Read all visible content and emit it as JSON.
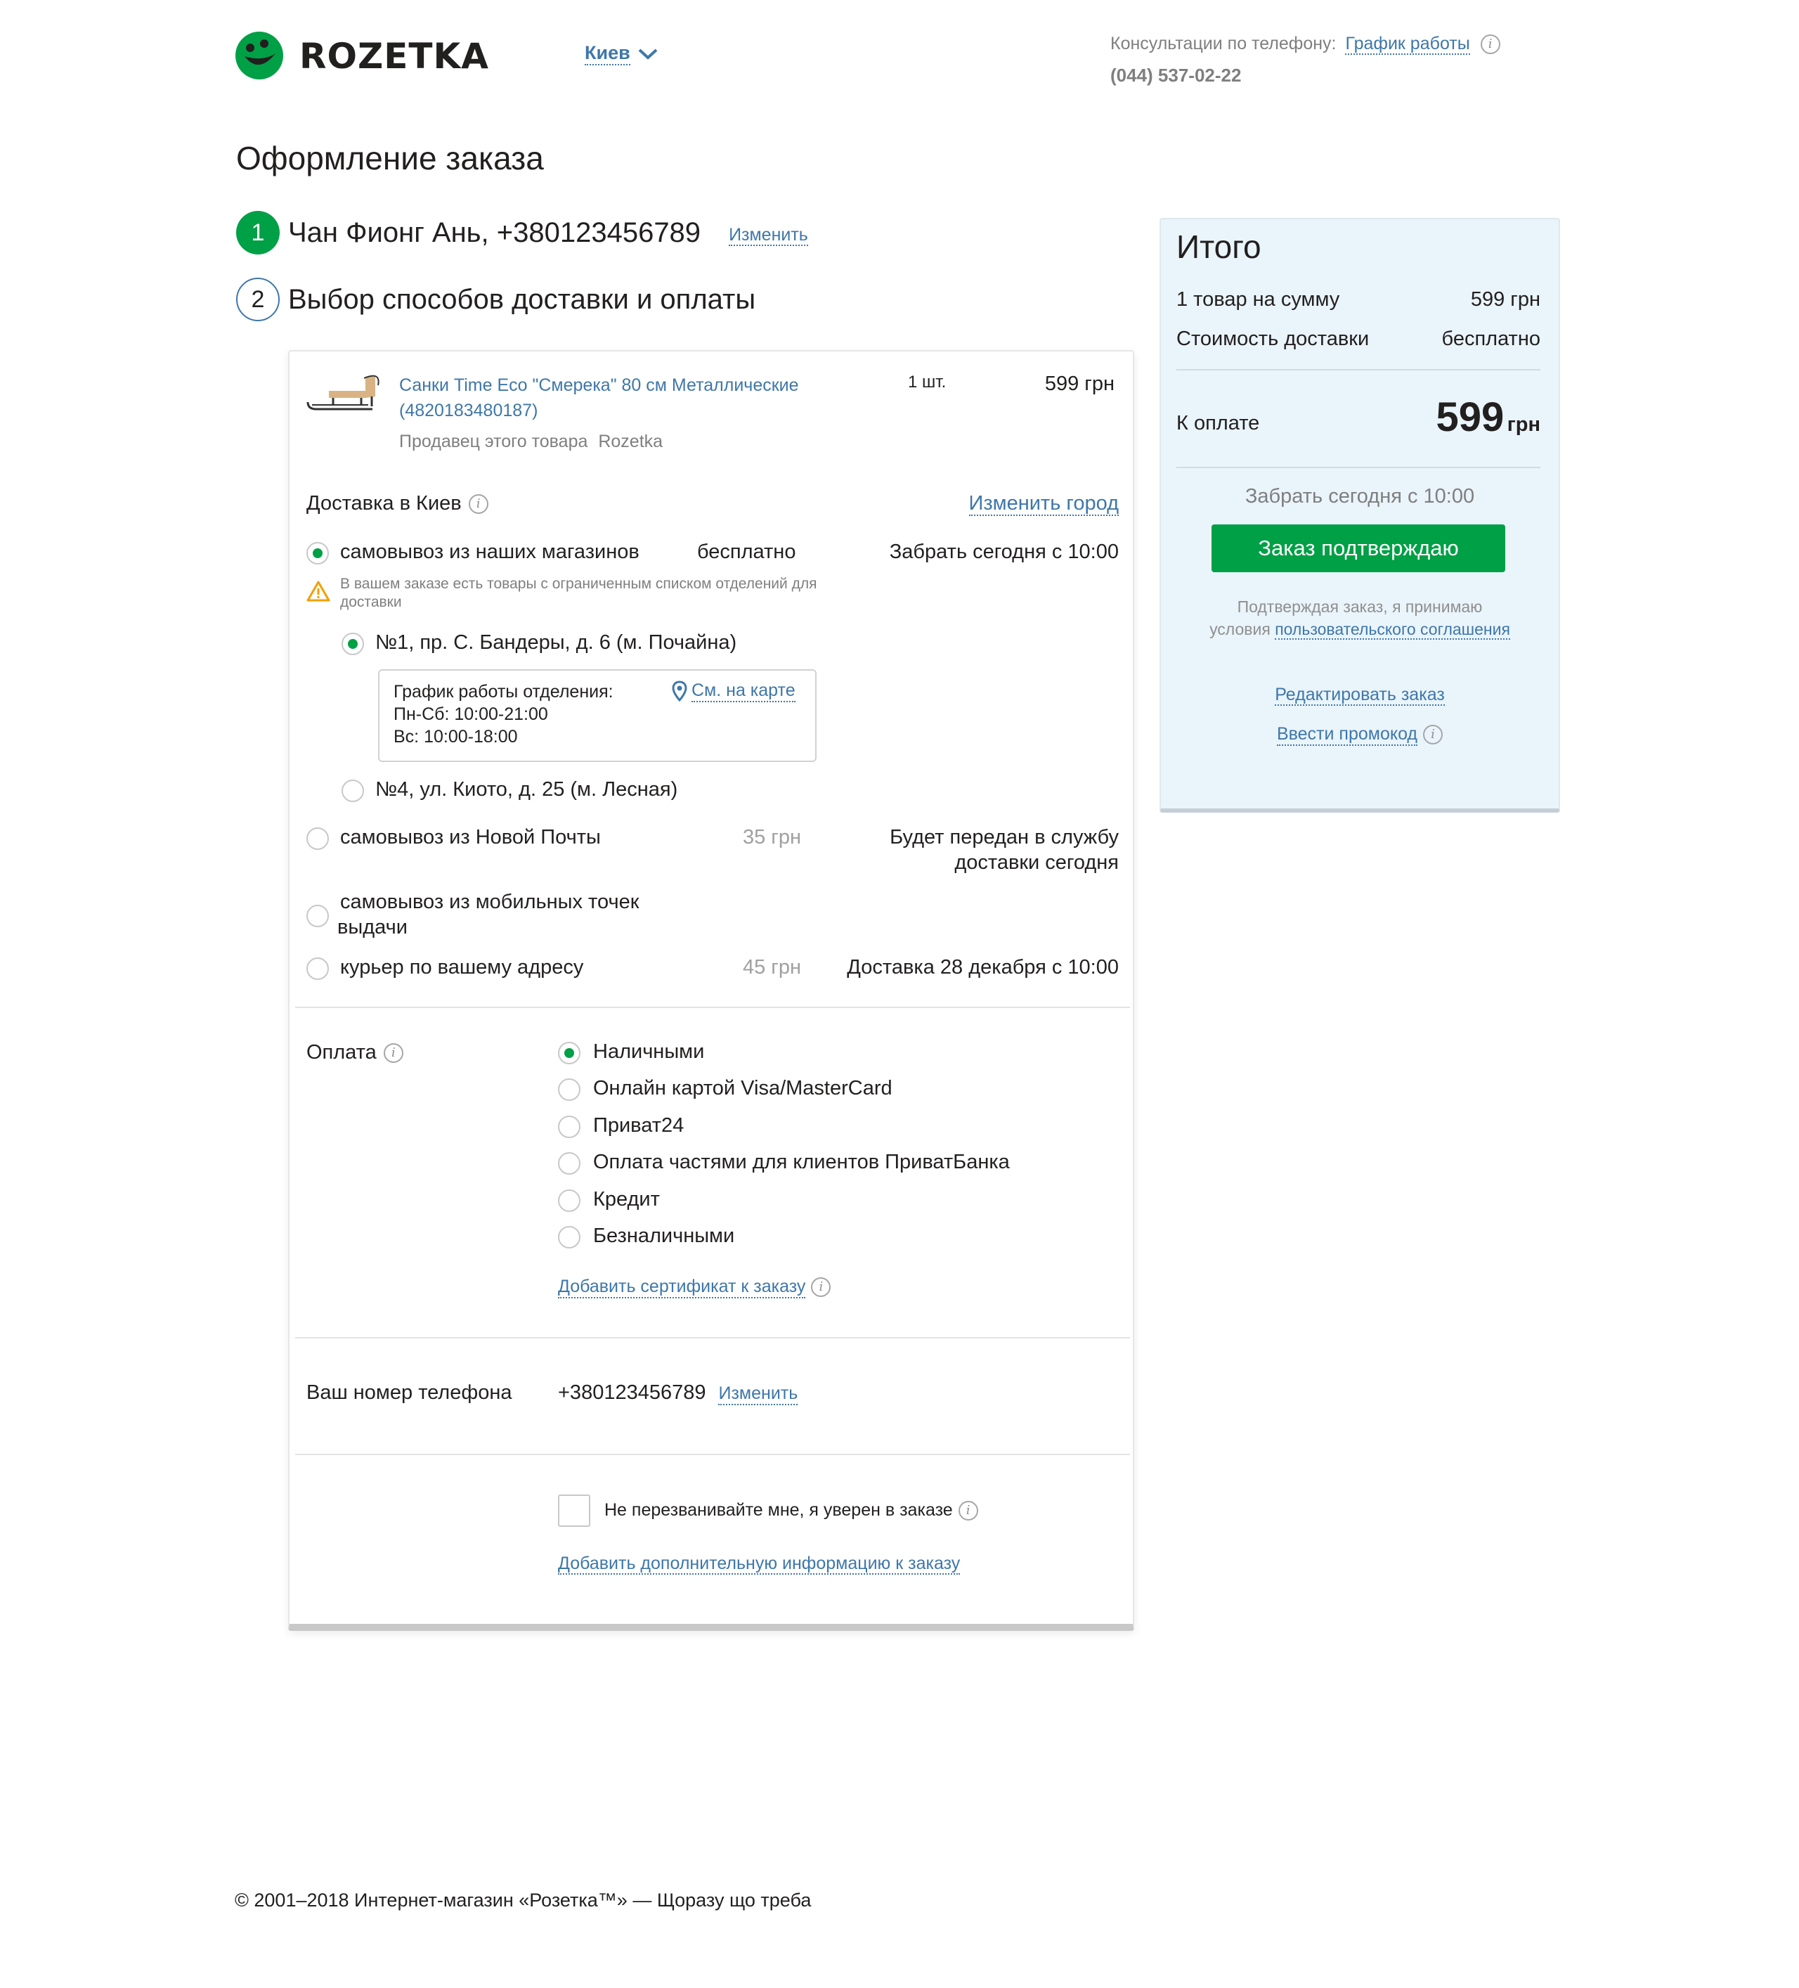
{
  "header": {
    "logo_text": "ROZETKA",
    "city": "Киев",
    "consult_label": "Консультации по телефону:",
    "schedule_link": "График работы",
    "phone": "(044) 537-02-22"
  },
  "page_title": "Оформление заказа",
  "steps": [
    {
      "num": "1",
      "title": "Чан Фионг Ань, +380123456789",
      "edit": "Изменить"
    },
    {
      "num": "2",
      "title": "Выбор способов доставки и оплаты"
    }
  ],
  "product": {
    "name": "Санки Time Eco \"Смерека\" 80 см Металлические (4820183480187)",
    "qty": "1 шт.",
    "price": "599 грн",
    "seller_label": "Продавец этого товара",
    "seller": "Rozetka"
  },
  "delivery": {
    "title": "Доставка в Киев",
    "change_city": "Изменить город",
    "options": [
      {
        "label": "самовывоз из наших магазинов",
        "price": "бесплатно",
        "note": "Забрать сегодня с 10:00",
        "selected": true
      },
      {
        "label": "самовывоз из Новой Почты",
        "price": "35 грн",
        "note_line1": "Будет передан в службу",
        "note_line2": "доставки сегодня"
      },
      {
        "label_line1": "самовывоз из мобильных точек",
        "label_line2": "выдачи"
      },
      {
        "label": "курьер по вашему адресу",
        "price": "45 грн",
        "note": "Доставка 28 декабря с 10:00"
      }
    ],
    "warning": "В вашем заказе есть товары с ограниченным списком отделений для доставки",
    "stores": [
      {
        "label": "№1, пр. С. Бандеры, д. 6 (м. Почайна)",
        "selected": true
      },
      {
        "label": "№4, ул. Киото, д. 25 (м. Лесная)"
      }
    ],
    "schedule": {
      "title": "График работы отделения:",
      "line1": "Пн-Сб: 10:00-21:00",
      "line2": "Вс: 10:00-18:00",
      "map_link": "См. на карте"
    }
  },
  "payment": {
    "title": "Оплата",
    "options": [
      "Наличными",
      "Онлайн картой Visa/MasterCard",
      "Приват24",
      "Оплата частями для клиентов ПриватБанка",
      "Кредит",
      "Безналичными"
    ],
    "selected_index": 0,
    "certificate_link": "Добавить сертификат к заказу"
  },
  "phone_section": {
    "label": "Ваш номер телефона",
    "value": "+380123456789",
    "edit": "Изменить"
  },
  "callback": {
    "checkbox_label": "Не перезванивайте мне, я уверен в заказе",
    "checked": false,
    "extra_link": "Добавить дополнительную информацию к заказу"
  },
  "summary": {
    "title": "Итого",
    "items_label": "1 товар на сумму",
    "items_value": "599 грн",
    "delivery_label": "Стоимость доставки",
    "delivery_value": "бесплатно",
    "pay_label": "К оплате",
    "pay_amount": "599",
    "pay_currency": "грн",
    "pickup_note": "Забрать сегодня с 10:00",
    "confirm_button": "Заказ подтверждаю",
    "agreement_line1": "Подтверждая заказ, я принимаю",
    "agreement_prefix": "условия",
    "agreement_link": "пользовательского соглашения",
    "edit_order": "Редактировать заказ",
    "promo": "Ввести промокод"
  },
  "footer": "© 2001–2018 Интернет-магазин «Розетка™» — Щоразу що треба",
  "colors": {
    "brand_green": "#00a046",
    "link_blue": "#3e77aa",
    "summary_bg": "#eaf4fb"
  }
}
